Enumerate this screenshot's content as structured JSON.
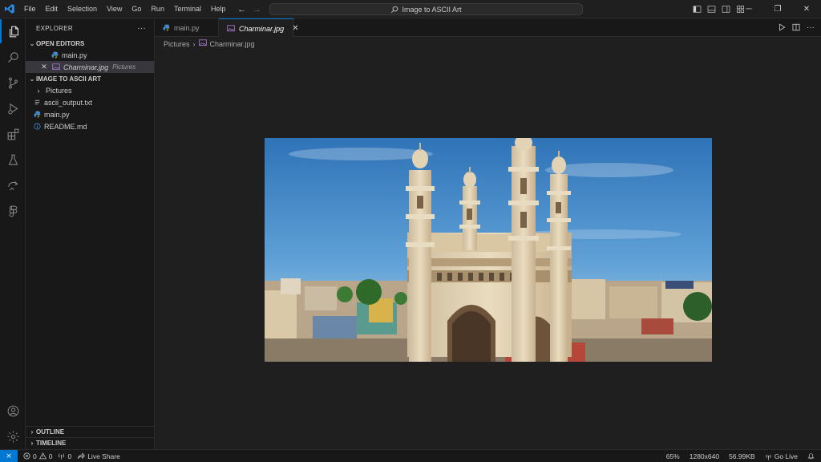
{
  "menu": [
    "File",
    "Edit",
    "Selection",
    "View",
    "Go",
    "Run",
    "Terminal",
    "Help"
  ],
  "command_center": {
    "text": "Image to ASCII Art"
  },
  "sidebar": {
    "title": "EXPLORER",
    "more": "···",
    "open_editors": {
      "label": "OPEN EDITORS",
      "items": [
        {
          "name": "main.py"
        },
        {
          "name": "Charminar.jpg",
          "description": "Pictures"
        }
      ]
    },
    "folder": {
      "label": "IMAGE TO ASCII ART",
      "items": [
        {
          "name": "Pictures"
        },
        {
          "name": "ascii_output.txt"
        },
        {
          "name": "main.py"
        },
        {
          "name": "README.md"
        }
      ]
    },
    "outline": "OUTLINE",
    "timeline": "TIMELINE"
  },
  "tabs": [
    {
      "label": "main.py"
    },
    {
      "label": "Charminar.jpg"
    }
  ],
  "breadcrumb": {
    "folder": "Pictures",
    "file": "Charminar.jpg"
  },
  "statusbar": {
    "errors": "0",
    "warnings": "0",
    "ports": "0",
    "live_share": "Live Share",
    "zoom": "65%",
    "dimensions": "1280x640",
    "size": "56.99KB",
    "go_live": "Go Live"
  },
  "colors": {
    "accent": "#0078d4",
    "python": "#3f8fd6",
    "info": "#3f8fd6"
  }
}
